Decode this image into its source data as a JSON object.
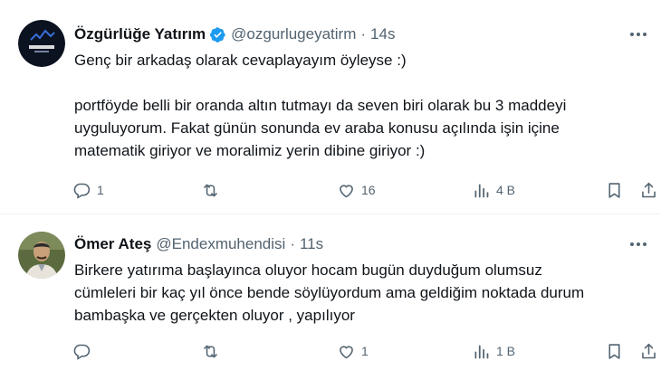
{
  "tweets": [
    {
      "display_name": "Özgürlüğe Yatırım",
      "verified": true,
      "handle": "@ozgurlugeyatirm",
      "separator": "·",
      "time": "14s",
      "avatar_text": "ÖZGÜRLÜĞE YATIRIM",
      "text_lines": [
        "Genç bir arkadaş olarak cevaplayayım öyleyse :)",
        "",
        "portföyde belli bir oranda altın tutmayı da seven biri olarak bu 3 maddeyi",
        "uyguluyorum. Fakat günün sonunda ev araba konusu açılında işin içine",
        "matematik giriyor ve moralimiz yerin dibine giriyor :)"
      ],
      "counts": {
        "replies": "1",
        "retweets": "",
        "likes": "16",
        "views": "4 B"
      }
    },
    {
      "display_name": "Ömer Ateş",
      "verified": false,
      "handle": "@Endexmuhendisi",
      "separator": "·",
      "time": "11s",
      "text_lines": [
        "Birkere yatırıma başlayınca oluyor hocam bugün duyduğum olumsuz",
        "cümleleri bir kaç yıl önce bende söylüyordum ama geldiğim noktada durum",
        "bambaşka ve gerçekten oluyor , yapılıyor"
      ],
      "counts": {
        "replies": "",
        "retweets": "",
        "likes": "1",
        "views": "1 B"
      }
    }
  ],
  "icons": {
    "reply": "reply-icon",
    "retweet": "retweet-icon",
    "like": "heart-icon",
    "views": "views-icon",
    "bookmark": "bookmark-icon",
    "share": "share-icon",
    "more": "more-icon",
    "verified": "verified-badge-icon"
  },
  "colors": {
    "text": "#0f1419",
    "muted": "#536471",
    "verified": "#1d9bf0",
    "divider": "#eff3f4"
  }
}
